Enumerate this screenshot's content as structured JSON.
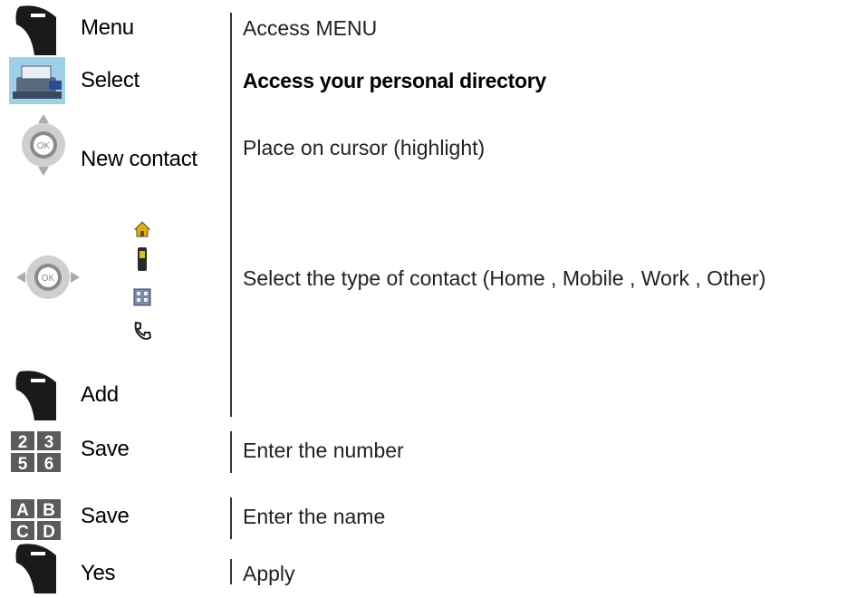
{
  "rows": [
    {
      "key_label": "Menu",
      "description": "Access MENU",
      "icon": "soft-key-icon"
    },
    {
      "key_label": "Select",
      "description": "Access your personal directory",
      "icon": "directory-icon"
    },
    {
      "key_label": "New contact",
      "description": "Place on cursor (highlight)",
      "icon": "navigator-up-down-icon"
    },
    {
      "key_label": "",
      "description": "Select the type of contact (Home , Mobile , Work , Other)",
      "icon": "navigator-left-right-icon"
    },
    {
      "key_label": "Add",
      "description": "",
      "icon": "soft-key-icon"
    },
    {
      "key_label": "Save",
      "description": "Enter the number",
      "icon": "numeric-keypad-icon"
    },
    {
      "key_label": "Save",
      "description": "Enter the name",
      "icon": "alpha-keypad-icon"
    },
    {
      "key_label": "Yes",
      "description": "Apply",
      "icon": "soft-key-icon"
    }
  ],
  "keypad_numeric": [
    "2",
    "3",
    "5",
    "6"
  ],
  "keypad_alpha": [
    "A",
    "B",
    "C",
    "D"
  ],
  "contact_type_icons": [
    "home-icon",
    "mobile-icon",
    "work-icon",
    "other-phone-icon"
  ],
  "ok_label": "OK",
  "colors": {
    "soft_key": "#1a1a1a",
    "keypad_key": "#5b5b5b",
    "navigator_ring": "#cfcfcf",
    "navigator_center": "#8a8a8a",
    "directory_bg": "#9fd0e8"
  }
}
